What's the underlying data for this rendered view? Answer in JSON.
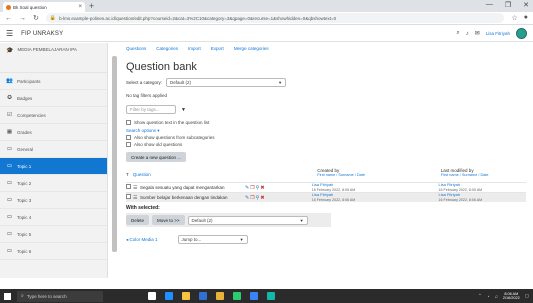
{
  "browser": {
    "tab_title": "Bk Soal question",
    "url": "b-lms.example-polines.ac.id/question/edit.php?courseid=2&cat=3%2C10&category=3&qpage=0&recurse=1&showhidden=0&qbshowtext=0",
    "window_controls": [
      "—",
      "❐",
      "✕"
    ]
  },
  "navbar": {
    "site_name": "FIP UNRAKSY",
    "username": "Lisa Fitriyah"
  },
  "sidebar": {
    "course_label": "MEDIA PEMBELAJARAN IPA",
    "items": [
      {
        "label": "Participants",
        "icon": "users-icon"
      },
      {
        "label": "Badges",
        "icon": "badge-icon"
      },
      {
        "label": "Competencies",
        "icon": "competencies-icon"
      },
      {
        "label": "Grades",
        "icon": "grades-icon"
      },
      {
        "label": "General",
        "icon": "folder-icon"
      },
      {
        "label": "Topic 1",
        "icon": "folder-icon",
        "active": true
      },
      {
        "label": "Topic 2",
        "icon": "folder-icon"
      },
      {
        "label": "Topic 3",
        "icon": "folder-icon"
      },
      {
        "label": "Topic 4",
        "icon": "folder-icon"
      },
      {
        "label": "Topic 5",
        "icon": "folder-icon"
      },
      {
        "label": "Topic 6",
        "icon": "folder-icon"
      }
    ]
  },
  "main": {
    "settings_nav": [
      "Questions",
      "Categories",
      "Import",
      "Export",
      "Merge categories"
    ],
    "title": "Question bank",
    "select_category_label": "Select a category:",
    "select_category_value": "Default (2)",
    "no_tag_filters": "No tag filters applied",
    "tag_filter_placeholder": "Filter by tags...",
    "show_text_label": "Show question text in the question list",
    "search_options": "Search options ▾",
    "subcategories_label": "Also show questions from subcategories",
    "old_questions": "Also show old questions",
    "create_button": "Create a new question ...",
    "table": {
      "sort_label": "T",
      "question_header": "Question",
      "created_by": "Created by",
      "created_sub": "First name / Surname / Date",
      "modified_by": "Last modified by",
      "modified_sub": "First name / Surname / Date",
      "rows": [
        {
          "name": "Segala sesuatu yang dapat mengantarkan",
          "creator": "Lisa Fitriyah",
          "created_date": "16 February 2022, 8:05 AM",
          "modifier": "Lisa Fitriyah",
          "modified_date": "16 February 2022, 8:05 AM"
        },
        {
          "name": "Sumber belajar berkenaan dengan tindakan",
          "creator": "Lisa Fitriyah",
          "created_date": "16 February 2022, 8:06 AM",
          "modifier": "Lisa Fitriyah",
          "modified_date": "16 February 2022, 8:06 AM"
        }
      ]
    },
    "with_selected": "With selected:",
    "delete_button": "Delete",
    "move_button": "Move to >>",
    "move_target": "Default (2)",
    "category_link": "◂ Color Media 1",
    "jump_placeholder": "Jump to..."
  },
  "taskbar": {
    "search_placeholder": "Type here to search",
    "time": "8:06 AM",
    "date": "2/16/2022",
    "apps": [
      {
        "name": "task-view",
        "color": "#ffffff"
      },
      {
        "name": "edge",
        "color": "#1e90ff"
      },
      {
        "name": "explorer",
        "color": "#f5c542"
      },
      {
        "name": "store",
        "color": "#2f6fd6"
      },
      {
        "name": "chrome",
        "color": "#e8b339"
      },
      {
        "name": "app-green",
        "color": "#2ecc71"
      },
      {
        "name": "app-blue",
        "color": "#3b82f6"
      },
      {
        "name": "app-teal",
        "color": "#14b8a6"
      }
    ]
  }
}
